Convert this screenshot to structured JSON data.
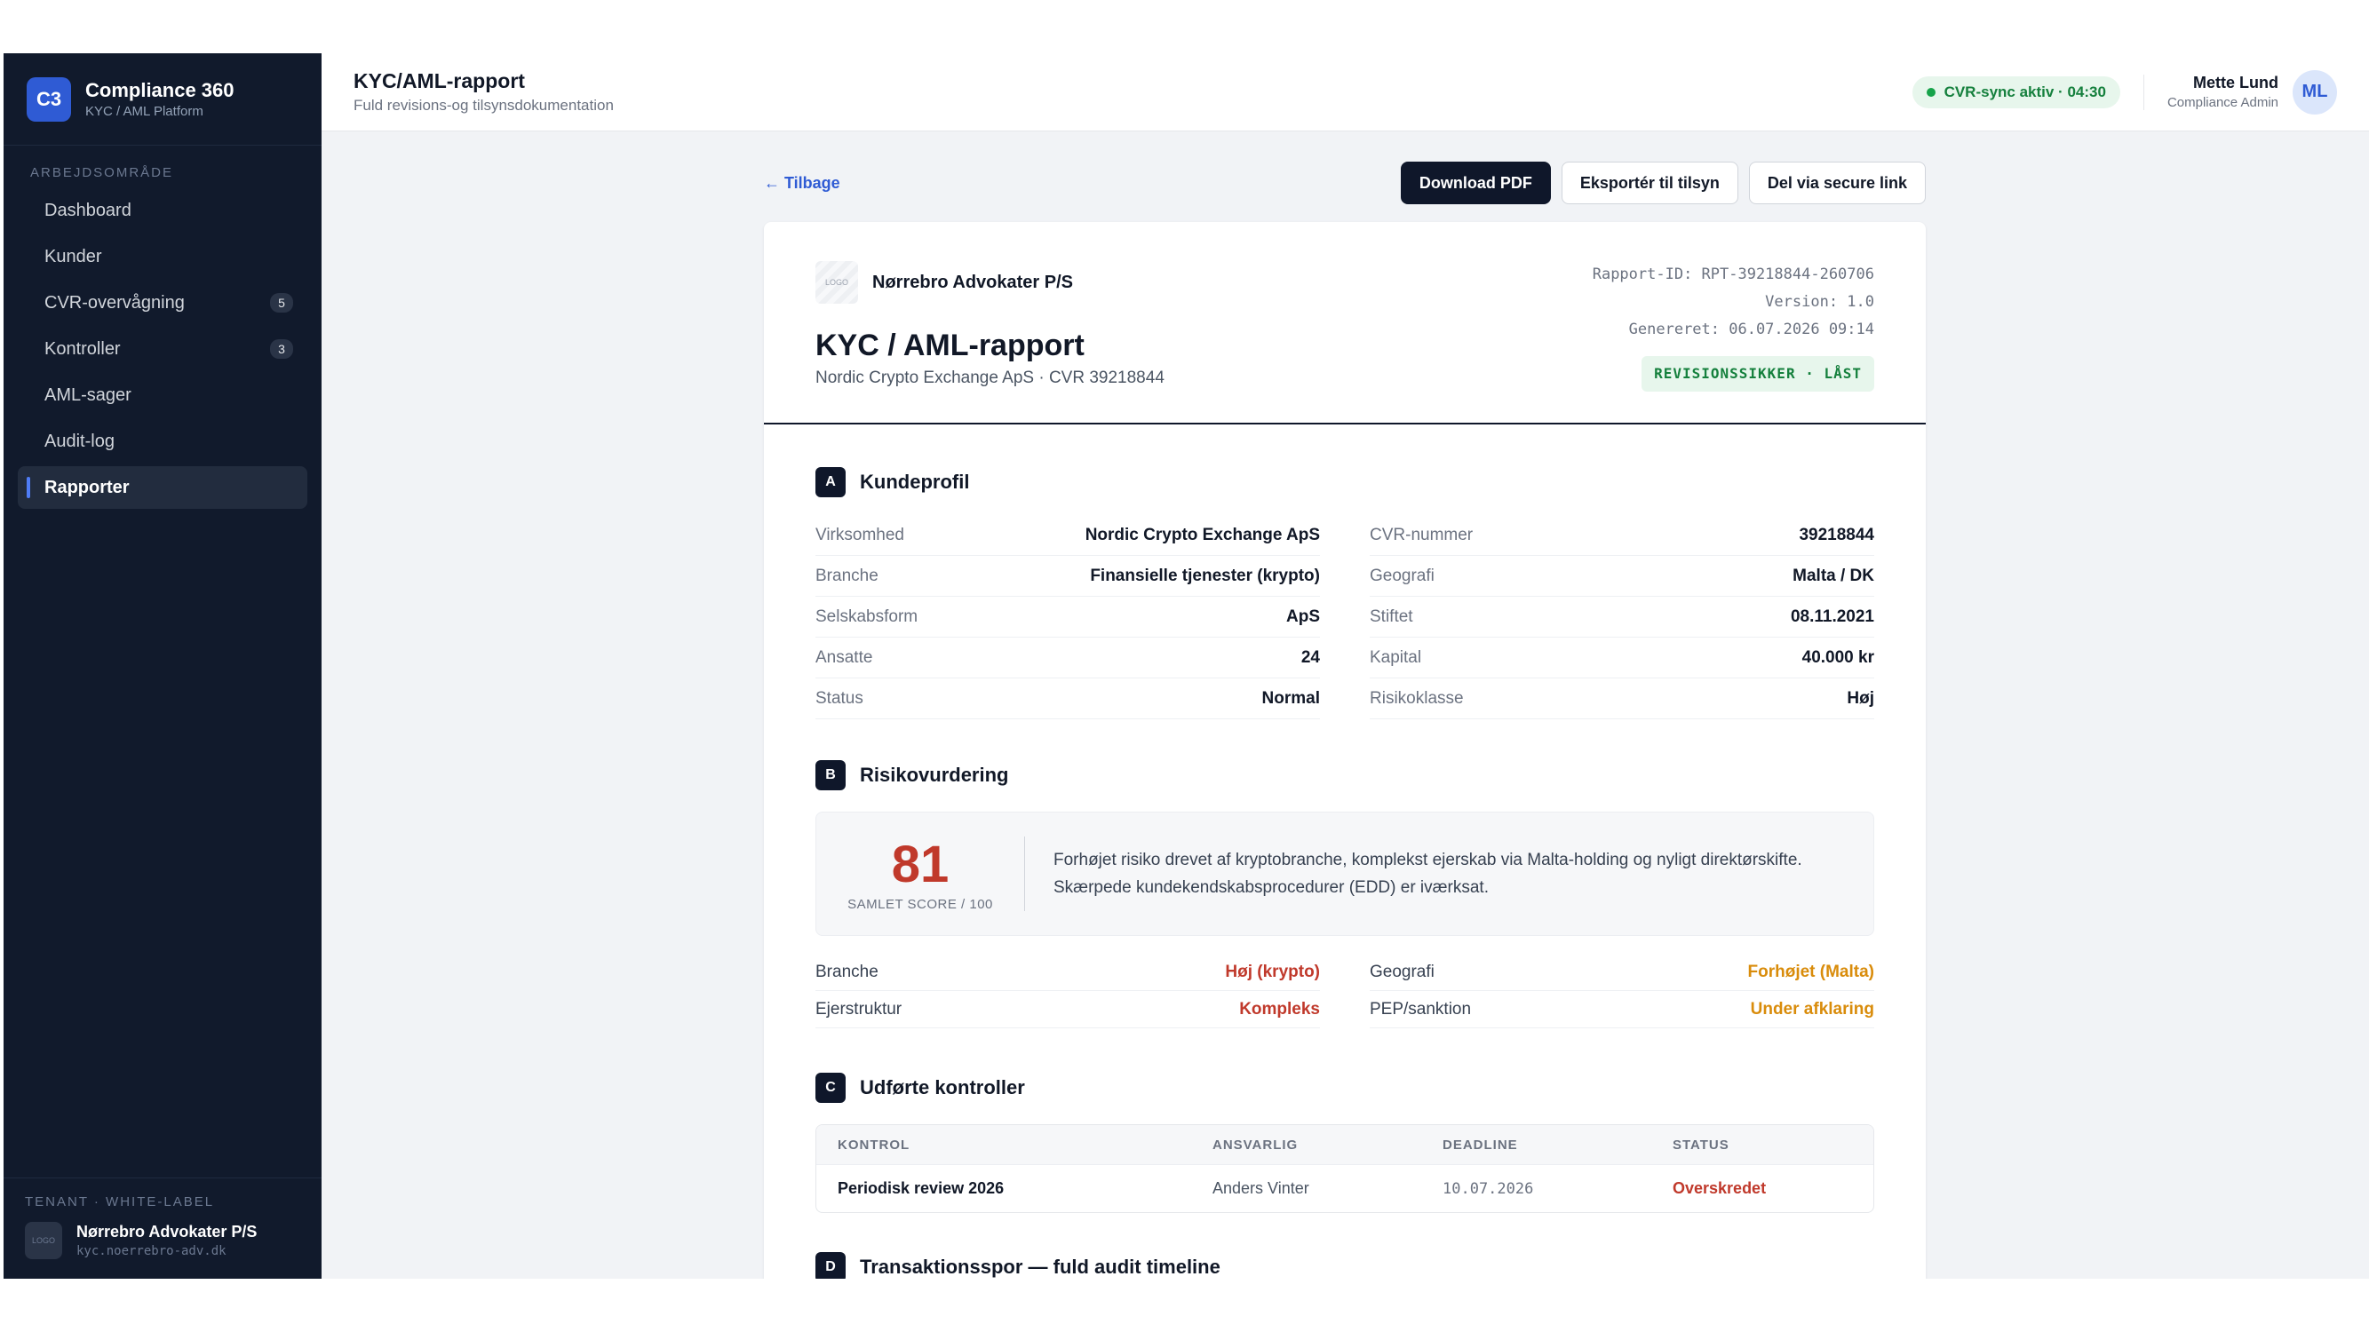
{
  "brand": {
    "logo": "C3",
    "title": "Compliance 360",
    "subtitle": "KYC / AML Platform"
  },
  "nav": {
    "section_label": "ARBEJDSOMRÅDE",
    "items": [
      {
        "label": "Dashboard",
        "badge": ""
      },
      {
        "label": "Kunder",
        "badge": ""
      },
      {
        "label": "CVR-overvågning",
        "badge": "5"
      },
      {
        "label": "Kontroller",
        "badge": "3"
      },
      {
        "label": "AML-sager",
        "badge": ""
      },
      {
        "label": "Audit-log",
        "badge": ""
      },
      {
        "label": "Rapporter",
        "badge": "",
        "active": true
      }
    ]
  },
  "tenant": {
    "label": "TENANT · WHITE-LABEL",
    "logo": "LOGO",
    "name": "Nørrebro Advokater P/S",
    "url": "kyc.noerrebro-adv.dk"
  },
  "topbar": {
    "title": "KYC/AML-rapport",
    "subtitle": "Fuld revisions-og tilsynsdokumentation",
    "sync_status": "CVR-sync aktiv · 04:30",
    "user_name": "Mette Lund",
    "user_role": "Compliance Admin",
    "user_initials": "ML"
  },
  "actions": {
    "back": "← Tilbage",
    "download": "Download PDF",
    "export": "Eksportér til tilsyn",
    "share": "Del via secure link"
  },
  "report": {
    "firm_logo": "LOGO",
    "firm_name": "Nørrebro Advokater P/S",
    "title": "KYC / AML-rapport",
    "subtitle": "Nordic Crypto Exchange ApS · CVR 39218844",
    "report_id": "Rapport-ID: RPT-39218844-260706",
    "version": "Version: 1.0",
    "generated": "Genereret: 06.07.2026 09:14",
    "locked_badge": "REVISIONSSIKKER · LÅST"
  },
  "kundeprofil": {
    "letter": "A",
    "title": "Kundeprofil",
    "left": [
      {
        "label": "Virksomhed",
        "value": "Nordic Crypto Exchange ApS"
      },
      {
        "label": "Branche",
        "value": "Finansielle tjenester (krypto)"
      },
      {
        "label": "Selskabsform",
        "value": "ApS"
      },
      {
        "label": "Ansatte",
        "value": "24"
      },
      {
        "label": "Status",
        "value": "Normal"
      }
    ],
    "right": [
      {
        "label": "CVR-nummer",
        "value": "39218844"
      },
      {
        "label": "Geografi",
        "value": "Malta / DK"
      },
      {
        "label": "Stiftet",
        "value": "08.11.2021"
      },
      {
        "label": "Kapital",
        "value": "40.000 kr"
      },
      {
        "label": "Risikoklasse",
        "value": "Høj"
      }
    ]
  },
  "risiko": {
    "letter": "B",
    "title": "Risikovurdering",
    "score": "81",
    "score_caption": "SAMLET SCORE / 100",
    "summary_line1": "Forhøjet risiko drevet af kryptobranche, komplekst ejerskab via Malta-holding og nyligt direktørskifte.",
    "summary_line2": "Skærpede kundekendskabsprocedurer (EDD) er iværksat.",
    "factors_left": [
      {
        "label": "Branche",
        "value": "Høj (krypto)"
      },
      {
        "label": "Ejerstruktur",
        "value": "Kompleks"
      }
    ],
    "factors_right": [
      {
        "label": "Geografi",
        "value": "Forhøjet (Malta)"
      },
      {
        "label": "PEP/sanktion",
        "value": "Under afklaring"
      }
    ],
    "colors": {
      "high": "#c0392b",
      "elevated": "#d98c0b"
    }
  },
  "kontroller": {
    "letter": "C",
    "title": "Udførte kontroller",
    "columns": [
      "KONTROL",
      "ANSVARLIG",
      "DEADLINE",
      "STATUS"
    ],
    "rows": [
      {
        "kontrol": "Periodisk review 2026",
        "ansvarlig": "Anders Vinter",
        "deadline": "10.07.2026",
        "status": "Overskredet"
      }
    ]
  },
  "timeline": {
    "letter": "D",
    "title": "Transaktionsspor — fuld audit timeline"
  }
}
